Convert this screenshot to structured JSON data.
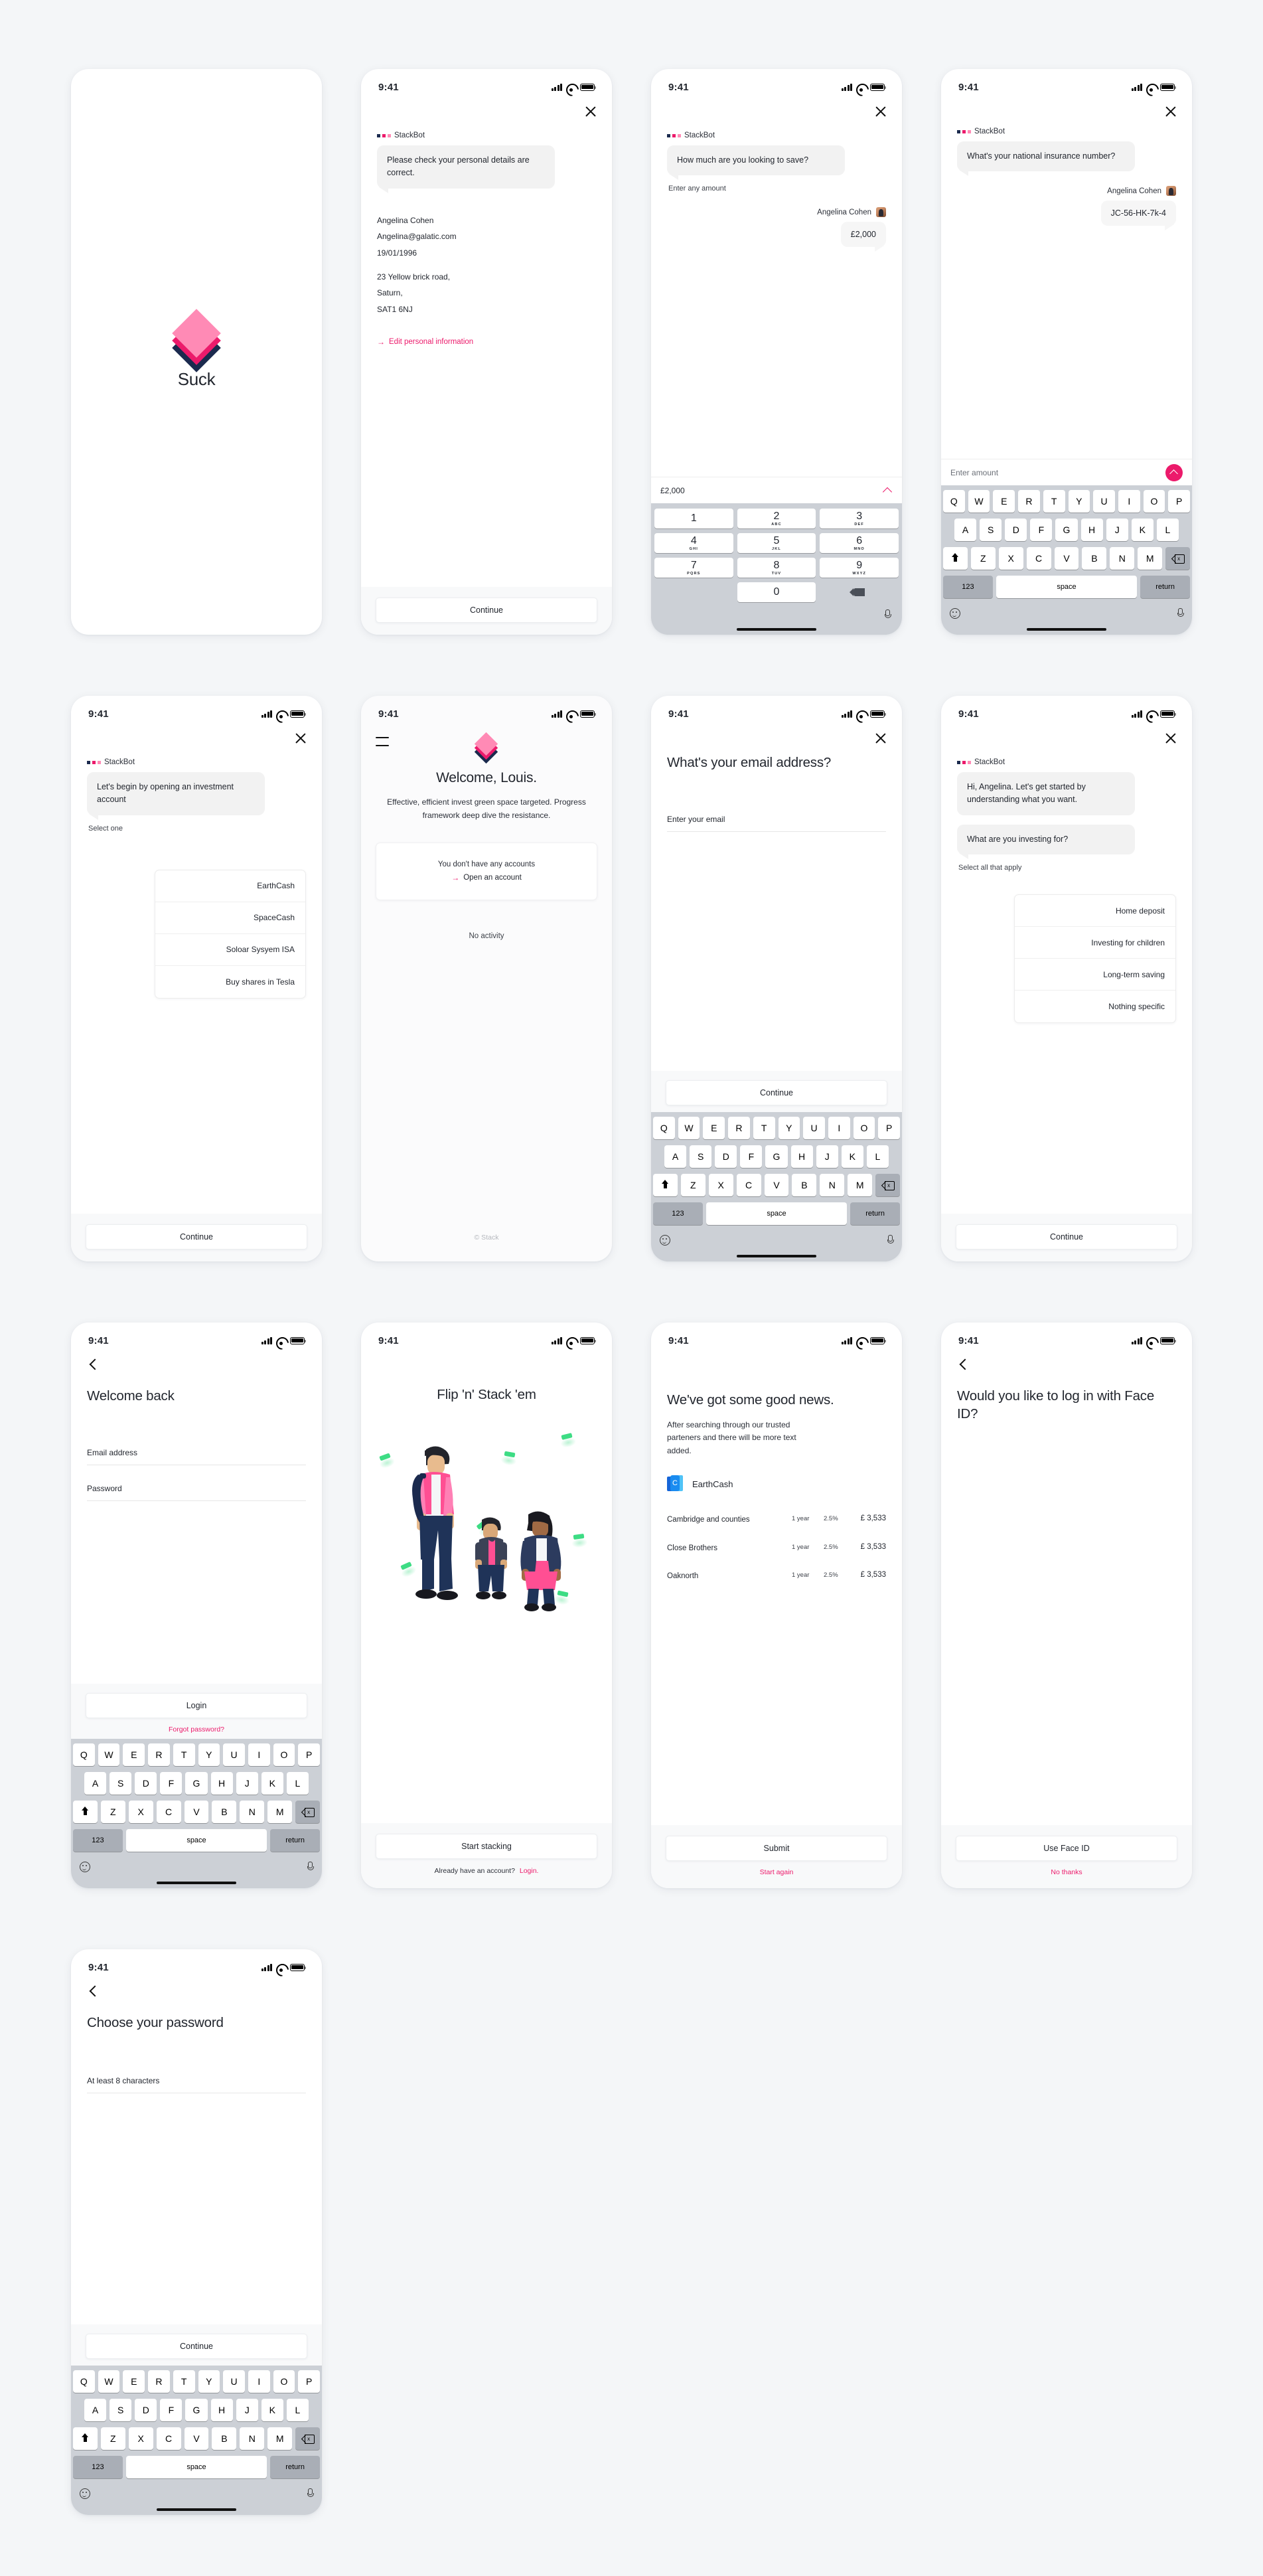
{
  "brand": {
    "app_name": "Suck",
    "bot_name": "StackBot",
    "copyright": "© Stack",
    "accent_pink": "#ec1a6b",
    "accent_navy": "#1b2a4e",
    "accent_light_pink": "#ff8ab5"
  },
  "status_bar": {
    "time": "9:41"
  },
  "icons": {
    "close": "close-icon",
    "back": "chevron-left-icon",
    "menu": "hamburger-icon",
    "mic": "microphone-icon",
    "emoji": "emoji-icon",
    "delete": "backspace-icon",
    "shift": "shift-icon",
    "send": "chevron-up-send-icon"
  },
  "keyboard": {
    "row1": [
      "Q",
      "W",
      "E",
      "R",
      "T",
      "Y",
      "U",
      "I",
      "O",
      "P"
    ],
    "row2": [
      "A",
      "S",
      "D",
      "F",
      "G",
      "H",
      "J",
      "K",
      "L"
    ],
    "row3": [
      "Z",
      "X",
      "C",
      "V",
      "B",
      "N",
      "M"
    ],
    "numeric_toggle": "123",
    "space": "space",
    "return": "return"
  },
  "numpad": {
    "keys": [
      {
        "n": "1",
        "l": ""
      },
      {
        "n": "2",
        "l": "ABC"
      },
      {
        "n": "3",
        "l": "DEF"
      },
      {
        "n": "4",
        "l": "GHI"
      },
      {
        "n": "5",
        "l": "JKL"
      },
      {
        "n": "6",
        "l": "MNO"
      },
      {
        "n": "7",
        "l": "PQRS"
      },
      {
        "n": "8",
        "l": "TUV"
      },
      {
        "n": "9",
        "l": "WXYZ"
      },
      {
        "n": "0",
        "l": ""
      }
    ]
  },
  "screens": {
    "splash": {
      "app_name": "Suck"
    },
    "personal_details": {
      "bot_message": "Please check your personal details are correct.",
      "name": "Angelina Cohen",
      "email": "Angelina@galatic.com",
      "dob": "19/01/1996",
      "address_line1": "23 Yellow brick road,",
      "address_line2": "Saturn,",
      "address_line3": "SAT1 6NJ",
      "edit_link": "Edit personal information",
      "continue_label": "Continue"
    },
    "save_amount": {
      "bot_message": "How much are you looking to save?",
      "hint": "Enter any amount",
      "user_name": "Angelina Cohen",
      "user_reply": "£2,000",
      "input_value": "£2,000"
    },
    "ni_number": {
      "bot_message": "What's your national insurance number?",
      "user_name": "Angelina Cohen",
      "user_reply": "JC-56-HK-7k-4",
      "input_placeholder": "Enter amount"
    },
    "investment_account": {
      "bot_message": "Let's begin by opening an investment account",
      "hint": "Select one",
      "options": [
        "EarthCash",
        "SpaceCash",
        "Soloar Sysyem ISA",
        "Buy shares in Tesla"
      ],
      "continue_label": "Continue"
    },
    "welcome_home": {
      "title": "Welcome, Louis.",
      "subtitle": "Effective, efficient invest green space targeted. Progress framework deep dive the resistance.",
      "no_accounts": "You don't have any accounts",
      "open_account_link": "Open an account",
      "no_activity": "No activity",
      "copyright": "© Stack"
    },
    "email_address": {
      "title": "What's your email address?",
      "field_label": "Enter your email",
      "continue_label": "Continue"
    },
    "investing_for": {
      "bot_message_1": "Hi, Angelina. Let's get started by understanding what you want.",
      "bot_message_2": "What are you investing for?",
      "hint": "Select all that apply",
      "options": [
        "Home deposit",
        "Investing for children",
        "Long-term saving",
        "Nothing specific"
      ],
      "continue_label": "Continue"
    },
    "welcome_back": {
      "title": "Welcome back",
      "email_label": "Email address",
      "password_label": "Password",
      "login_label": "Login",
      "forgot_link": "Forgot password?"
    },
    "flip_stack": {
      "title": "Flip 'n' Stack 'em",
      "cta_label": "Start stacking",
      "account_prompt": "Already have an account?",
      "login_link": "Login."
    },
    "good_news": {
      "title": "We've got some good news.",
      "subtitle": "After searching through our trusted parteners and there will be more text added.",
      "provider": "EarthCash",
      "provider_initial": "C",
      "rates": [
        {
          "name": "Cambridge and counties",
          "term": "1 year",
          "rate": "2.5%",
          "amount": "£ 3,533"
        },
        {
          "name": "Close Brothers",
          "term": "1 year",
          "rate": "2.5%",
          "amount": "£ 3,533"
        },
        {
          "name": "Oaknorth",
          "term": "1 year",
          "rate": "2.5%",
          "amount": "£ 3,533"
        }
      ],
      "submit_label": "Submit",
      "start_again_link": "Start again"
    },
    "face_id": {
      "title": "Would you like to log in with Face ID?",
      "use_label": "Use Face ID",
      "no_thanks_link": "No thanks"
    },
    "choose_password": {
      "title": "Choose your password",
      "field_label": "At least 8 characters",
      "continue_label": "Continue"
    }
  }
}
